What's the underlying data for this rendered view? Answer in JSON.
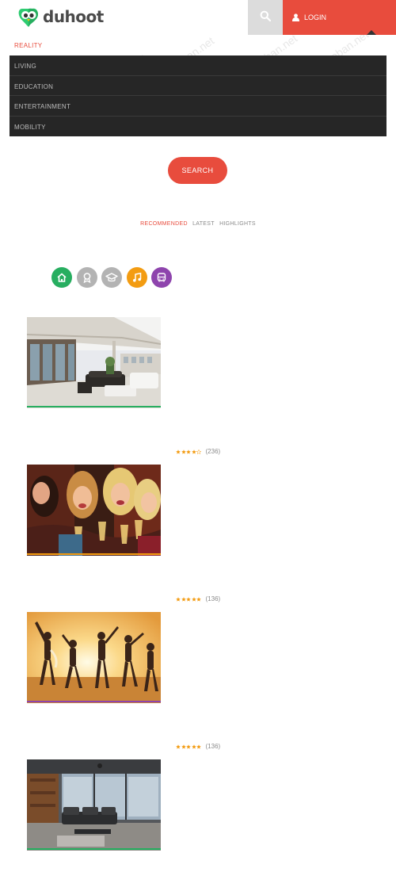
{
  "brand": {
    "name": "duhoot"
  },
  "header": {
    "login_label": "LOGIN"
  },
  "nav": {
    "active": "REALITY",
    "items": [
      "LIVING",
      "EDUCATION",
      "ENTERTAINMENT",
      "MOBILITY"
    ]
  },
  "search": {
    "button_label": "SEARCH"
  },
  "tabs": [
    "RECOMMENDED",
    "LATEST",
    "HIGHLIGHTS"
  ],
  "categories": [
    {
      "icon": "home-icon",
      "color": "#27ae60"
    },
    {
      "icon": "award-icon",
      "color": "#b3b3b3"
    },
    {
      "icon": "graduation-cap-icon",
      "color": "#b3b3b3"
    },
    {
      "icon": "music-icon",
      "color": "#f39c12"
    },
    {
      "icon": "bus-icon",
      "color": "#8e44ad"
    }
  ],
  "listings": [
    {
      "image": "apartment-terrace",
      "accent": "#27ae60"
    },
    {
      "image": "party-friends",
      "accent": "#f39c12",
      "rating": 4,
      "reviews": "(236)"
    },
    {
      "image": "beach-dancers",
      "accent": "#8e44ad",
      "rating": 5,
      "reviews": "(136)"
    },
    {
      "image": "modern-living-room",
      "accent": "#27ae60",
      "rating": 5,
      "reviews": "(136)"
    }
  ],
  "watermark": "webmoban.net",
  "colors": {
    "primary": "#e84c3d",
    "dark": "#262626",
    "star": "#f39c12"
  }
}
